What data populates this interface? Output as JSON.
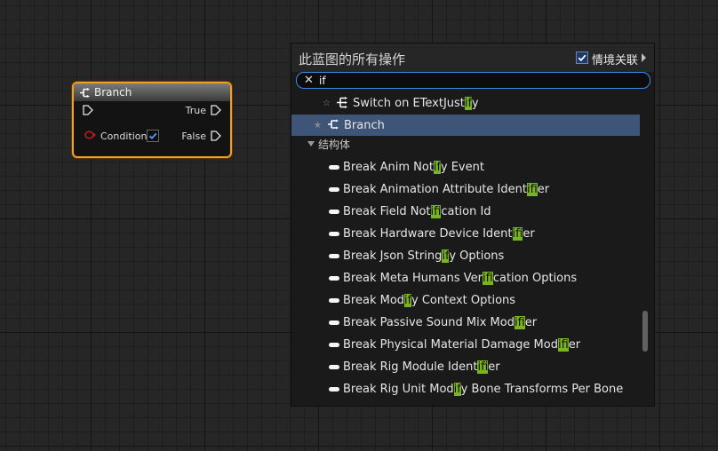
{
  "node": {
    "title": "Branch",
    "exec_in_label": "",
    "true_label": "True",
    "condition_label": "Condition",
    "false_label": "False",
    "condition_checked": true
  },
  "menu": {
    "title": "此蓝图的所有操作",
    "context_label": "情境关联",
    "context_checked": true,
    "search": {
      "value": "if",
      "placeholder": ""
    },
    "items": [
      {
        "label": "Switch on ETextJustify",
        "kind": "function",
        "starred": false
      },
      {
        "label": "Branch",
        "kind": "branch",
        "starred": true,
        "selected": true
      }
    ],
    "category": "结构体",
    "struct_items": [
      "Break Anim Notify Event",
      "Break Animation Attribute Identifier",
      "Break Field Notification Id",
      "Break Hardware Device Identifier",
      "Break Json Stringify Options",
      "Break Meta Humans Verification Options",
      "Break Modify Context Options",
      "Break Passive Sound Mix Modifier",
      "Break Physical Material Damage Modifier",
      "Break Rig Module Identifier",
      "Break Rig Unit Modify Bone Transforms Per Bone"
    ],
    "highlight": "if"
  },
  "colors": {
    "node_border": "#f0a020",
    "selection": "#3e5577",
    "highlight": "#78b51e",
    "search_border": "#3a8ee6"
  }
}
